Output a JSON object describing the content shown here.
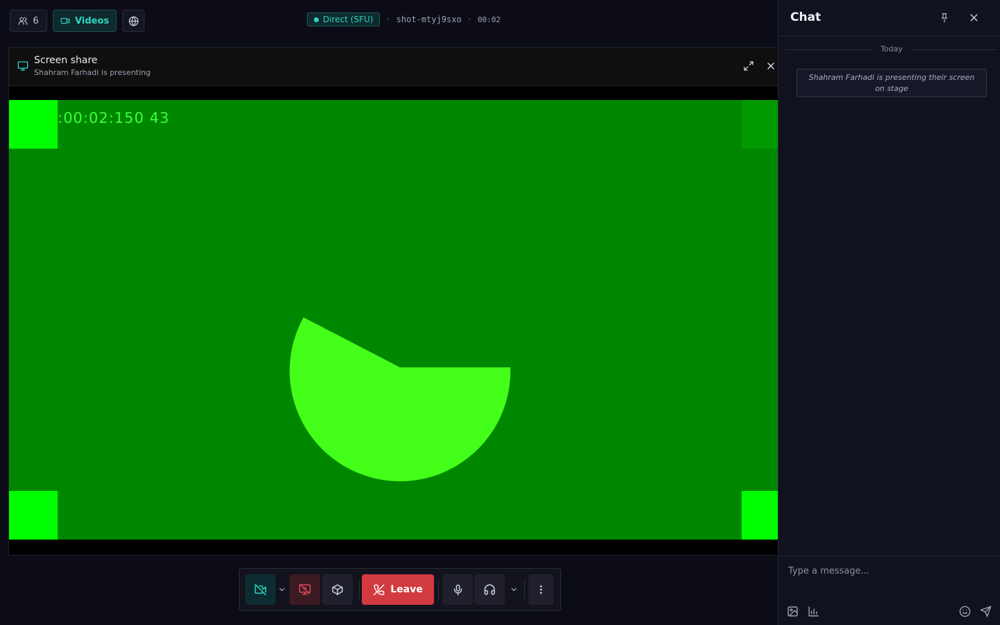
{
  "topbar": {
    "participants_count": "6",
    "videos_label": "Videos",
    "connection_badge": "Direct (SFU)",
    "separator": "·",
    "shot_id": "shot-mtyj9sxo",
    "elapsed": "00:02"
  },
  "share": {
    "title": "Screen share",
    "subtitle": "Shahram Farhadi is presenting",
    "video_timestamp": ":00:02:150 43"
  },
  "controls": {
    "leave_label": "Leave",
    "icons": [
      "camera-off-icon",
      "chevron-down-icon",
      "screen-share-off-icon",
      "cube-icon",
      "phone-hangup-icon",
      "microphone-icon",
      "headphones-icon",
      "chevron-down-icon",
      "more-vertical-icon"
    ]
  },
  "chat": {
    "title": "Chat",
    "day_divider": "Today",
    "system_message": "Shahram Farhadi is presenting their screen on stage",
    "input_placeholder": "Type a message..."
  },
  "colors": {
    "accent": "#2fd3c2",
    "leave": "#d13b40",
    "stage_bg": "#008700",
    "marker": "#00ff00",
    "pie": "#44ff1a"
  }
}
